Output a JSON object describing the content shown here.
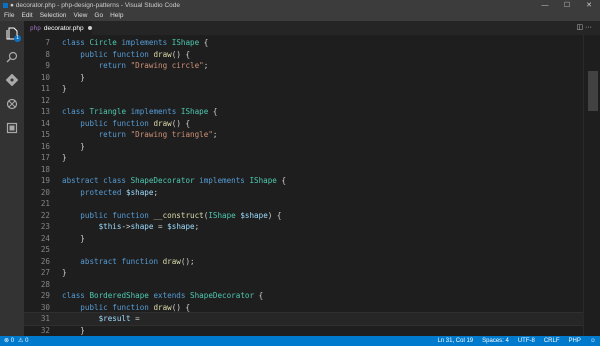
{
  "window": {
    "title": "● decorator.php - php-design-patterns - Visual Studio Code",
    "controls": [
      "—",
      "☐",
      "✕"
    ]
  },
  "menu": [
    "File",
    "Edit",
    "Selection",
    "View",
    "Go",
    "Help"
  ],
  "activity_bar": {
    "items": [
      "files-icon",
      "search-icon",
      "source-control-icon",
      "debug-icon",
      "extensions-icon"
    ],
    "files_badge": "1"
  },
  "tab": {
    "file_icon": "php",
    "label": "decorator.php",
    "modified": true,
    "actions": "◫ ···"
  },
  "editor": {
    "current_line": 31,
    "lines": [
      {
        "n": "7",
        "t": [
          [
            "kw",
            "class "
          ],
          [
            "cls",
            "Circle "
          ],
          [
            "kw",
            "implements "
          ],
          [
            "cls",
            "IShape "
          ],
          [
            "plain",
            "{"
          ]
        ]
      },
      {
        "n": "8",
        "t": [
          [
            "plain",
            "    "
          ],
          [
            "kw",
            "public function "
          ],
          [
            "fn",
            "draw"
          ],
          [
            "plain",
            "() {"
          ]
        ]
      },
      {
        "n": "9",
        "t": [
          [
            "plain",
            "        "
          ],
          [
            "kw",
            "return "
          ],
          [
            "str",
            "\"Drawing circle\""
          ],
          [
            "plain",
            ";"
          ]
        ]
      },
      {
        "n": "10",
        "t": [
          [
            "plain",
            "    }"
          ]
        ]
      },
      {
        "n": "11",
        "t": [
          [
            "plain",
            "}"
          ]
        ]
      },
      {
        "n": "12",
        "t": []
      },
      {
        "n": "13",
        "t": [
          [
            "kw",
            "class "
          ],
          [
            "cls",
            "Triangle "
          ],
          [
            "kw",
            "implements "
          ],
          [
            "cls",
            "IShape "
          ],
          [
            "plain",
            "{"
          ]
        ]
      },
      {
        "n": "14",
        "t": [
          [
            "plain",
            "    "
          ],
          [
            "kw",
            "public function "
          ],
          [
            "fn",
            "draw"
          ],
          [
            "plain",
            "() {"
          ]
        ]
      },
      {
        "n": "15",
        "t": [
          [
            "plain",
            "        "
          ],
          [
            "kw",
            "return "
          ],
          [
            "str",
            "\"Drawing triangle\""
          ],
          [
            "plain",
            ";"
          ]
        ]
      },
      {
        "n": "16",
        "t": [
          [
            "plain",
            "    }"
          ]
        ]
      },
      {
        "n": "17",
        "t": [
          [
            "plain",
            "}"
          ]
        ]
      },
      {
        "n": "18",
        "t": []
      },
      {
        "n": "19",
        "t": [
          [
            "kw",
            "abstract class "
          ],
          [
            "cls",
            "ShapeDecorator "
          ],
          [
            "kw",
            "implements "
          ],
          [
            "cls",
            "IShape "
          ],
          [
            "plain",
            "{"
          ]
        ]
      },
      {
        "n": "20",
        "t": [
          [
            "plain",
            "    "
          ],
          [
            "kw",
            "protected "
          ],
          [
            "var",
            "$shape"
          ],
          [
            "plain",
            ";"
          ]
        ]
      },
      {
        "n": "21",
        "t": []
      },
      {
        "n": "22",
        "t": [
          [
            "plain",
            "    "
          ],
          [
            "kw",
            "public function "
          ],
          [
            "fn",
            "__construct"
          ],
          [
            "plain",
            "("
          ],
          [
            "cls",
            "IShape "
          ],
          [
            "var",
            "$shape"
          ],
          [
            "plain",
            ") {"
          ]
        ]
      },
      {
        "n": "23",
        "t": [
          [
            "plain",
            "        "
          ],
          [
            "var",
            "$this"
          ],
          [
            "plain",
            "->"
          ],
          [
            "var",
            "shape"
          ],
          [
            "plain",
            " = "
          ],
          [
            "var",
            "$shape"
          ],
          [
            "plain",
            ";"
          ]
        ]
      },
      {
        "n": "24",
        "t": [
          [
            "plain",
            "    }"
          ]
        ]
      },
      {
        "n": "25",
        "t": []
      },
      {
        "n": "26",
        "t": [
          [
            "plain",
            "    "
          ],
          [
            "kw",
            "abstract function "
          ],
          [
            "fn",
            "draw"
          ],
          [
            "plain",
            "();"
          ]
        ]
      },
      {
        "n": "27",
        "t": [
          [
            "plain",
            "}"
          ]
        ]
      },
      {
        "n": "28",
        "t": []
      },
      {
        "n": "29",
        "t": [
          [
            "kw",
            "class "
          ],
          [
            "cls",
            "BorderedShape "
          ],
          [
            "kw",
            "extends "
          ],
          [
            "cls",
            "ShapeDecorator "
          ],
          [
            "plain",
            "{"
          ]
        ]
      },
      {
        "n": "30",
        "t": [
          [
            "plain",
            "    "
          ],
          [
            "kw",
            "public function "
          ],
          [
            "fn",
            "draw"
          ],
          [
            "plain",
            "() {"
          ]
        ]
      },
      {
        "n": "31",
        "t": [
          [
            "plain",
            "        "
          ],
          [
            "var",
            "$result"
          ],
          [
            "plain",
            " ="
          ]
        ]
      },
      {
        "n": "32",
        "t": [
          [
            "plain",
            "    }"
          ]
        ]
      },
      {
        "n": "33",
        "t": [
          [
            "plain",
            "}"
          ]
        ]
      }
    ]
  },
  "status": {
    "errors": "⊗ 0",
    "warnings": "⚠ 0",
    "position": "Ln 31, Col 19",
    "spaces": "Spaces: 4",
    "encoding": "UTF-8",
    "eol": "CRLF",
    "language": "PHP",
    "feedback": "☺"
  },
  "colors": {
    "status_bar": "#007acc",
    "editor_bg": "#1e1e1e",
    "keyword": "#569cd6",
    "class": "#4ec9b0",
    "function": "#dcdcaa",
    "string": "#ce9178",
    "variable": "#9cdcfe"
  }
}
